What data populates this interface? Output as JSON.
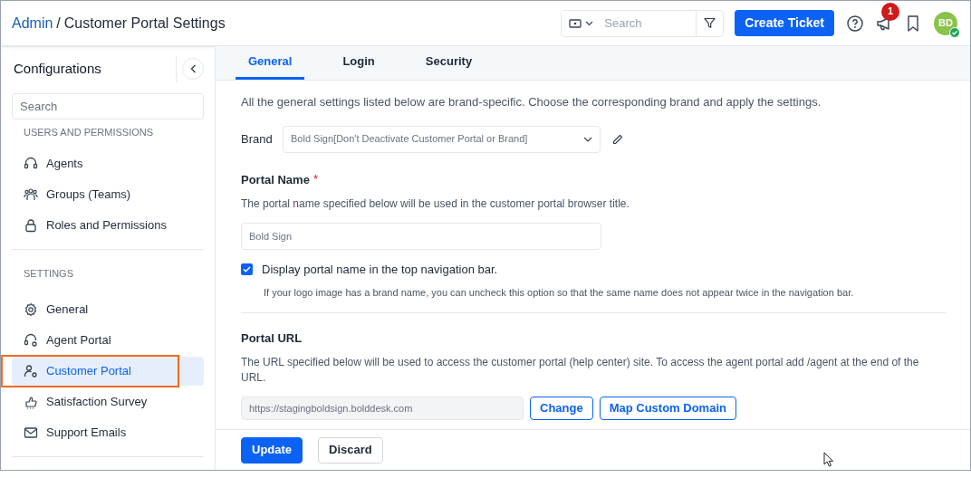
{
  "header": {
    "breadcrumb_root": "Admin",
    "breadcrumb_separator": "/",
    "title": "Customer Portal Settings",
    "search": {
      "placeholder": "Search"
    },
    "create_button": "Create Ticket",
    "notification_count": "1",
    "avatar": "BD"
  },
  "sidebar": {
    "title": "Configurations",
    "search": {
      "placeholder": "Search"
    },
    "sections": [
      {
        "heading": "USERS AND PERMISSIONS",
        "items": [
          {
            "label": "Agents",
            "selected": false,
            "highlighted": false
          },
          {
            "label": "Groups (Teams)",
            "selected": false,
            "highlighted": false
          },
          {
            "label": "Roles and Permissions",
            "selected": false,
            "highlighted": false
          }
        ]
      },
      {
        "heading": "SETTINGS",
        "items": [
          {
            "label": "General",
            "selected": false,
            "highlighted": false
          },
          {
            "label": "Agent Portal",
            "selected": false,
            "highlighted": false
          },
          {
            "label": "Customer Portal",
            "selected": true,
            "highlighted": true
          },
          {
            "label": "Satisfaction Survey",
            "selected": false,
            "highlighted": false
          },
          {
            "label": "Support Emails",
            "selected": false,
            "highlighted": false
          }
        ]
      }
    ]
  },
  "tabs": [
    {
      "label": "General",
      "selected": true
    },
    {
      "label": "Login",
      "selected": false
    },
    {
      "label": "Security",
      "selected": false
    }
  ],
  "content": {
    "intro": "All the general settings listed below are brand-specific. Choose the corresponding brand and apply the settings.",
    "brand": {
      "label": "Brand",
      "value": "Bold Sign[Don't Deactivate Customer Portal or Brand]"
    },
    "portal_name": {
      "label": "Portal Name",
      "required_mark": "*",
      "description": "The portal name specified below will be used in the customer portal browser title.",
      "value": "Bold Sign"
    },
    "display_option": {
      "label": "Display portal name in the top navigation bar.",
      "checked": true,
      "hint": "If your logo image has a brand name, you can uncheck this option so that the same name does not appear twice in the navigation bar."
    },
    "portal_url": {
      "label": "Portal URL",
      "description": "The URL specified below will be used to access the customer portal (help center) site. To access the agent portal add /agent at the end of the URL.",
      "value": "https://stagingboldsign.bolddesk.com",
      "buttons": [
        "Change",
        "Map Custom Domain"
      ]
    }
  },
  "footer": {
    "buttons": [
      {
        "label": "Update",
        "kind": "primary"
      },
      {
        "label": "Discard",
        "kind": "secondary"
      }
    ]
  }
}
